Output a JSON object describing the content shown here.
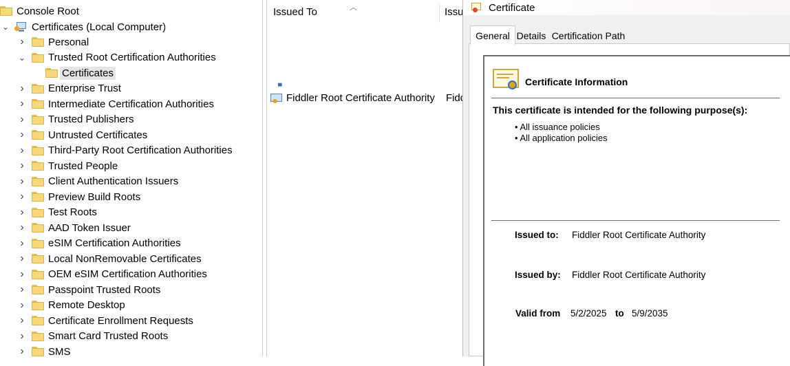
{
  "tree": {
    "root": "Console Root",
    "computer": "Certificates (Local Computer)",
    "items": [
      {
        "label": "Personal"
      },
      {
        "label": "Trusted Root Certification Authorities",
        "expanded": true
      },
      {
        "label": "Certificates",
        "selected": true
      },
      {
        "label": "Enterprise Trust"
      },
      {
        "label": "Intermediate Certification Authorities"
      },
      {
        "label": "Trusted Publishers"
      },
      {
        "label": "Untrusted Certificates"
      },
      {
        "label": "Third-Party Root Certification Authorities"
      },
      {
        "label": "Trusted People"
      },
      {
        "label": "Client Authentication Issuers"
      },
      {
        "label": "Preview Build Roots"
      },
      {
        "label": "Test Roots"
      },
      {
        "label": "AAD Token Issuer"
      },
      {
        "label": "eSIM Certification Authorities"
      },
      {
        "label": "Local NonRemovable Certificates"
      },
      {
        "label": "OEM eSIM Certification Authorities"
      },
      {
        "label": "Passpoint Trusted Roots"
      },
      {
        "label": "Remote Desktop"
      },
      {
        "label": "Certificate Enrollment Requests"
      },
      {
        "label": "Smart Card Trusted Roots"
      },
      {
        "label": "SMS"
      }
    ]
  },
  "list": {
    "columns": [
      "Issued To",
      "Issu"
    ],
    "row": {
      "issued_to": "Fiddler Root Certificate Authority",
      "issued_by_partial": "Fiddc"
    }
  },
  "dialog": {
    "title": "Certificate",
    "tabs": [
      "General",
      "Details",
      "Certification Path"
    ],
    "active_tab": "General",
    "info_title": "Certificate Information",
    "purpose_heading": "This certificate is intended for the following purpose(s):",
    "purposes": [
      "• All issuance policies",
      "• All application policies"
    ],
    "issued_to_label": "Issued to:",
    "issued_to": "Fiddler Root Certificate Authority",
    "issued_by_label": "Issued by:",
    "issued_by": "Fiddler Root Certificate Authority",
    "valid_from_label": "Valid from",
    "valid_from": "5/2/2025",
    "to_label": "to",
    "valid_to": "5/9/2035"
  },
  "colors": {
    "folder": "#f6d77a",
    "selection": "#e5e5e5",
    "dialog_bg": "#f0f0f0"
  }
}
